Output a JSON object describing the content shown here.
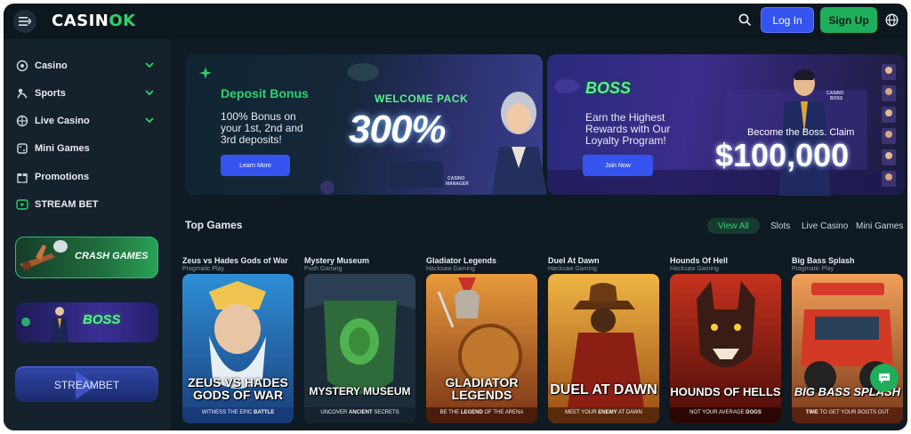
{
  "header": {
    "logo_prefix": "CASIN",
    "logo_suffix": "OK",
    "login_label": "Log In",
    "signup_label": "Sign Up"
  },
  "sidebar": {
    "items": [
      {
        "label": "Casino",
        "icon": "casino-chip-icon",
        "expandable": true
      },
      {
        "label": "Sports",
        "icon": "sports-icon",
        "expandable": true
      },
      {
        "label": "Live Casino",
        "icon": "live-casino-icon",
        "expandable": true
      },
      {
        "label": "Mini Games",
        "icon": "mini-games-icon",
        "expandable": false
      },
      {
        "label": "Promotions",
        "icon": "gift-icon",
        "expandable": false
      },
      {
        "label": "STREAM BET",
        "icon": "play-icon",
        "expandable": false
      }
    ],
    "crash_label": "CRASH GAMES",
    "boss_label": "BOSS",
    "stream_label": "STREAMBET"
  },
  "banners": {
    "deposit": {
      "title": "Deposit Bonus",
      "text_line1": "100% Bonus on",
      "text_line2": "your 1st, 2nd and",
      "text_line3": "3rd deposits!",
      "button": "Learn More",
      "welcome": "WELCOME PACK",
      "percent": "300%",
      "tag_line1": "CASINO",
      "tag_line2": "MANAGER"
    },
    "boss": {
      "logo": "BOSS",
      "text_line1": "Earn the Highest",
      "text_line2": "Rewards with Our",
      "text_line3": "Loyalty Program!",
      "button": "Join Now",
      "become": "Become the Boss. Claim",
      "amount": "$100,000",
      "tag_line1": "CASINO",
      "tag_line2": "BOSS"
    }
  },
  "top_games": {
    "title": "Top Games",
    "filters": [
      "View All",
      "Slots",
      "Live Casino",
      "Mini Games"
    ],
    "games": [
      {
        "name": "Zeus vs Hades Gods of War",
        "provider": "Pragmatic Play",
        "art_title_1": "ZEUS VS HADES",
        "art_title_2": "GODS OF WAR",
        "tag_plain": "WITNESS THE EPIC ",
        "tag_bold": "BATTLE"
      },
      {
        "name": "Mystery Museum",
        "provider": "Push Gaming",
        "art_title_1": "MYSTERY MUSEUM",
        "art_title_2": "",
        "tag_plain": "UNCOVER ",
        "tag_bold": "ANCIENT",
        "tag_after": " SECRETS"
      },
      {
        "name": "Gladiator Legends",
        "provider": "Hacksaw Gaming",
        "art_title_1": "GLADIATOR",
        "art_title_2": "LEGENDS",
        "tag_plain": "BE THE ",
        "tag_bold": "LEGEND",
        "tag_after": " OF THE ARENA"
      },
      {
        "name": "Duel At Dawn",
        "provider": "Hacksaw Gaming",
        "art_title_1": "DUEL AT DAWN",
        "art_title_2": "",
        "tag_plain": "MEET YOUR ",
        "tag_bold": "ENEMY",
        "tag_after": " AT DAWN"
      },
      {
        "name": "Hounds Of Hell",
        "provider": "Hacksaw Gaming",
        "art_title_1": "HOUNDS OF HELLS",
        "art_title_2": "",
        "tag_plain": "NOT YOUR AVERAGE ",
        "tag_bold": "DOGS"
      },
      {
        "name": "Big Bass Splash",
        "provider": "Pragmatic Play",
        "art_title_1": "BIG BASS SPLASH",
        "art_title_2": "",
        "tag_plain": "",
        "tag_bold": "TIME",
        "tag_after": " TO GET YOUR BOOTS OUT"
      }
    ]
  },
  "colors": {
    "brand_green": "#2bd36f",
    "primary_blue": "#3553ee",
    "background": "#0f1a22",
    "sidebar": "#15212b"
  }
}
